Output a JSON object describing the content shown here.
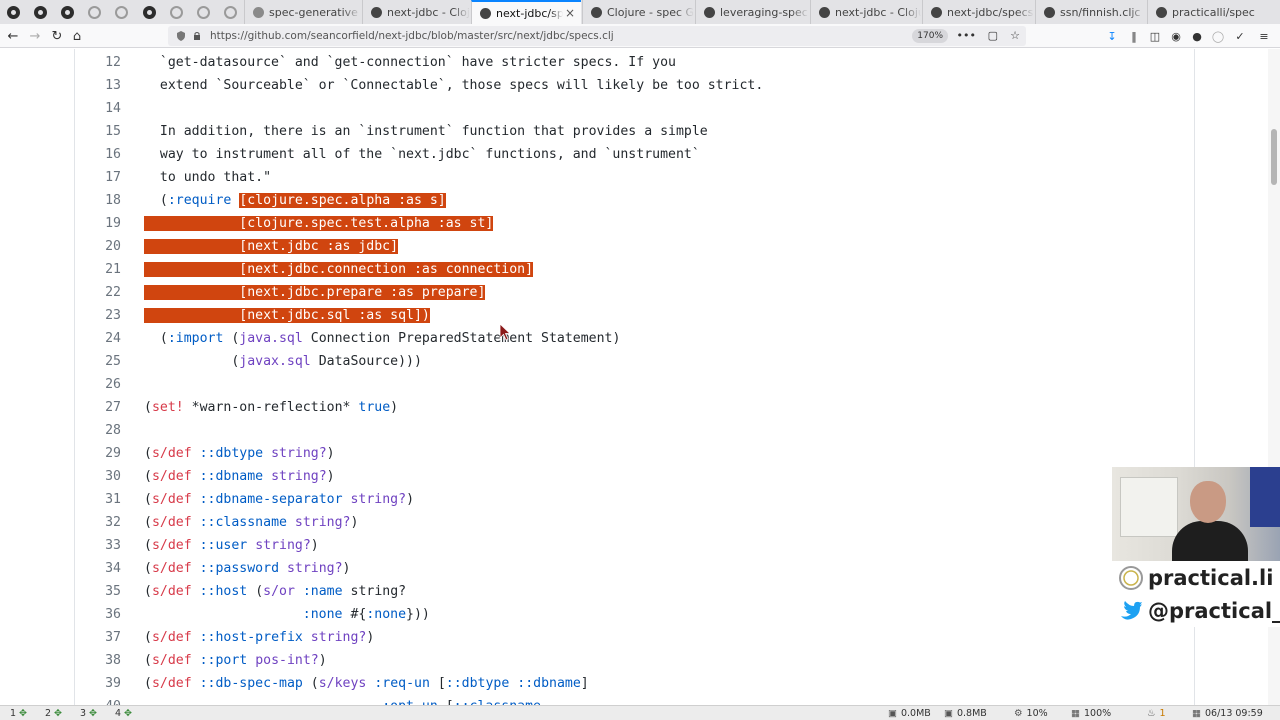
{
  "browser": {
    "tabs": [
      {
        "label": "spec-generative",
        "faded": true
      },
      {
        "label": "next-jdbc - Cloj",
        "faded": false
      },
      {
        "label": "next-jdbc/specs",
        "faded": false,
        "active": true
      },
      {
        "label": "Clojure - spec G",
        "faded": false
      },
      {
        "label": "leveraging-spec",
        "faded": false
      },
      {
        "label": "next-jdbc - Cloju",
        "faded": false
      },
      {
        "label": "next-jdbc/specs",
        "faded": false
      },
      {
        "label": "ssn/finnish.cljc",
        "faded": false
      },
      {
        "label": "practicalli/spec",
        "faded": false
      }
    ],
    "tab_close_glyph": "×",
    "url": "https://github.com/seancorfield/next-jdbc/blob/master/src/next/jdbc/specs.clj",
    "zoom": "170%",
    "page_actions": "•••"
  },
  "code": {
    "lines": [
      {
        "num": "12",
        "segments": [
          {
            "t": "  `get-datasource` and `get-connection` have stricter specs. If you",
            "c": "sym"
          }
        ]
      },
      {
        "num": "13",
        "segments": [
          {
            "t": "  extend `Sourceable` or `Connectable`, those specs will likely be too strict.",
            "c": "sym"
          }
        ]
      },
      {
        "num": "14",
        "segments": []
      },
      {
        "num": "15",
        "segments": [
          {
            "t": "  In addition, there is an `instrument` function that provides a simple",
            "c": "sym"
          }
        ]
      },
      {
        "num": "16",
        "segments": [
          {
            "t": "  way to instrument all of the `next.jdbc` functions, and `unstrument`",
            "c": "sym"
          }
        ]
      },
      {
        "num": "17",
        "segments": [
          {
            "t": "  to undo that.\"",
            "c": "sym"
          }
        ]
      },
      {
        "num": "18",
        "segments": [
          {
            "t": "  (",
            "c": "sym"
          },
          {
            "t": ":require",
            "c": "kw"
          },
          {
            "t": " ",
            "c": "sym"
          },
          {
            "t": "[clojure.spec.alpha :as s]",
            "c": "sel"
          }
        ]
      },
      {
        "num": "19",
        "segments": [
          {
            "t": "            [clojure.spec.test.alpha :as st]",
            "c": "sel"
          }
        ]
      },
      {
        "num": "20",
        "segments": [
          {
            "t": "            [next.jdbc :as jdbc]",
            "c": "sel"
          }
        ]
      },
      {
        "num": "21",
        "segments": [
          {
            "t": "            [next.jdbc.connection :as connection]",
            "c": "sel"
          }
        ]
      },
      {
        "num": "22",
        "segments": [
          {
            "t": "            [next.jdbc.prepare :as prepare]",
            "c": "sel"
          }
        ]
      },
      {
        "num": "23",
        "segments": [
          {
            "t": "            [next.jdbc.sql :as sql])",
            "c": "sel"
          }
        ]
      },
      {
        "num": "24",
        "segments": [
          {
            "t": "  (",
            "c": "sym"
          },
          {
            "t": ":import",
            "c": "kw"
          },
          {
            "t": " (",
            "c": "sym"
          },
          {
            "t": "java.sql",
            "c": "pkg"
          },
          {
            "t": " Connection PreparedStatement Statement)",
            "c": "sym"
          }
        ]
      },
      {
        "num": "25",
        "segments": [
          {
            "t": "           (",
            "c": "sym"
          },
          {
            "t": "javax.sql",
            "c": "pkg"
          },
          {
            "t": " DataSource)))",
            "c": "sym"
          }
        ]
      },
      {
        "num": "26",
        "segments": []
      },
      {
        "num": "27",
        "segments": [
          {
            "t": "(",
            "c": "sym"
          },
          {
            "t": "set!",
            "c": "d"
          },
          {
            "t": " *warn-on-reflection* ",
            "c": "sym"
          },
          {
            "t": "true",
            "c": "kw"
          },
          {
            "t": ")",
            "c": "sym"
          }
        ]
      },
      {
        "num": "28",
        "segments": []
      },
      {
        "num": "29",
        "segments": [
          {
            "t": "(",
            "c": "sym"
          },
          {
            "t": "s/def",
            "c": "d"
          },
          {
            "t": " ",
            "c": "sym"
          },
          {
            "t": "::dbtype",
            "c": "kw"
          },
          {
            "t": " ",
            "c": "sym"
          },
          {
            "t": "string?",
            "c": "fn"
          },
          {
            "t": ")",
            "c": "sym"
          }
        ]
      },
      {
        "num": "30",
        "segments": [
          {
            "t": "(",
            "c": "sym"
          },
          {
            "t": "s/def",
            "c": "d"
          },
          {
            "t": " ",
            "c": "sym"
          },
          {
            "t": "::dbname",
            "c": "kw"
          },
          {
            "t": " ",
            "c": "sym"
          },
          {
            "t": "string?",
            "c": "fn"
          },
          {
            "t": ")",
            "c": "sym"
          }
        ]
      },
      {
        "num": "31",
        "segments": [
          {
            "t": "(",
            "c": "sym"
          },
          {
            "t": "s/def",
            "c": "d"
          },
          {
            "t": " ",
            "c": "sym"
          },
          {
            "t": "::dbname-separator",
            "c": "kw"
          },
          {
            "t": " ",
            "c": "sym"
          },
          {
            "t": "string?",
            "c": "fn"
          },
          {
            "t": ")",
            "c": "sym"
          }
        ]
      },
      {
        "num": "32",
        "segments": [
          {
            "t": "(",
            "c": "sym"
          },
          {
            "t": "s/def",
            "c": "d"
          },
          {
            "t": " ",
            "c": "sym"
          },
          {
            "t": "::classname",
            "c": "kw"
          },
          {
            "t": " ",
            "c": "sym"
          },
          {
            "t": "string?",
            "c": "fn"
          },
          {
            "t": ")",
            "c": "sym"
          }
        ]
      },
      {
        "num": "33",
        "segments": [
          {
            "t": "(",
            "c": "sym"
          },
          {
            "t": "s/def",
            "c": "d"
          },
          {
            "t": " ",
            "c": "sym"
          },
          {
            "t": "::user",
            "c": "kw"
          },
          {
            "t": " ",
            "c": "sym"
          },
          {
            "t": "string?",
            "c": "fn"
          },
          {
            "t": ")",
            "c": "sym"
          }
        ]
      },
      {
        "num": "34",
        "segments": [
          {
            "t": "(",
            "c": "sym"
          },
          {
            "t": "s/def",
            "c": "d"
          },
          {
            "t": " ",
            "c": "sym"
          },
          {
            "t": "::password",
            "c": "kw"
          },
          {
            "t": " ",
            "c": "sym"
          },
          {
            "t": "string?",
            "c": "fn"
          },
          {
            "t": ")",
            "c": "sym"
          }
        ]
      },
      {
        "num": "35",
        "segments": [
          {
            "t": "(",
            "c": "sym"
          },
          {
            "t": "s/def",
            "c": "d"
          },
          {
            "t": " ",
            "c": "sym"
          },
          {
            "t": "::host",
            "c": "kw"
          },
          {
            "t": " (",
            "c": "sym"
          },
          {
            "t": "s/or",
            "c": "fn"
          },
          {
            "t": " ",
            "c": "sym"
          },
          {
            "t": ":name",
            "c": "kw"
          },
          {
            "t": " string?",
            "c": "sym"
          }
        ]
      },
      {
        "num": "36",
        "segments": [
          {
            "t": "                    ",
            "c": "sym"
          },
          {
            "t": ":none",
            "c": "kw"
          },
          {
            "t": " #{",
            "c": "sym"
          },
          {
            "t": ":none",
            "c": "kw"
          },
          {
            "t": "}))",
            "c": "sym"
          }
        ]
      },
      {
        "num": "37",
        "segments": [
          {
            "t": "(",
            "c": "sym"
          },
          {
            "t": "s/def",
            "c": "d"
          },
          {
            "t": " ",
            "c": "sym"
          },
          {
            "t": "::host-prefix",
            "c": "kw"
          },
          {
            "t": " ",
            "c": "sym"
          },
          {
            "t": "string?",
            "c": "fn"
          },
          {
            "t": ")",
            "c": "sym"
          }
        ]
      },
      {
        "num": "38",
        "segments": [
          {
            "t": "(",
            "c": "sym"
          },
          {
            "t": "s/def",
            "c": "d"
          },
          {
            "t": " ",
            "c": "sym"
          },
          {
            "t": "::port",
            "c": "kw"
          },
          {
            "t": " ",
            "c": "sym"
          },
          {
            "t": "pos-int?",
            "c": "fn"
          },
          {
            "t": ")",
            "c": "sym"
          }
        ]
      },
      {
        "num": "39",
        "segments": [
          {
            "t": "(",
            "c": "sym"
          },
          {
            "t": "s/def",
            "c": "d"
          },
          {
            "t": " ",
            "c": "sym"
          },
          {
            "t": "::db-spec-map",
            "c": "kw"
          },
          {
            "t": " (",
            "c": "sym"
          },
          {
            "t": "s/keys",
            "c": "fn"
          },
          {
            "t": " ",
            "c": "sym"
          },
          {
            "t": ":req-un",
            "c": "kw"
          },
          {
            "t": " [",
            "c": "sym"
          },
          {
            "t": "::dbtype",
            "c": "kw"
          },
          {
            "t": " ",
            "c": "sym"
          },
          {
            "t": "::dbname",
            "c": "kw"
          },
          {
            "t": "]",
            "c": "sym"
          }
        ]
      },
      {
        "num": "40",
        "segments": [
          {
            "t": "                              ",
            "c": "sym"
          },
          {
            "t": ":opt-un",
            "c": "kw"
          },
          {
            "t": " [",
            "c": "sym"
          },
          {
            "t": "::classname",
            "c": "kw"
          }
        ]
      }
    ]
  },
  "overlay": {
    "handle_site": "practical.li",
    "handle_twitter": "@practical_li"
  },
  "status": {
    "workspaces": [
      {
        "num": "1"
      },
      {
        "num": "2"
      },
      {
        "num": "3"
      },
      {
        "num": "4"
      }
    ],
    "net_down": "0.0MB",
    "net_up": "0.8MB",
    "cpu": "10%",
    "mem": "100%",
    "notifications": "1",
    "datetime": "06/13 09:59"
  }
}
